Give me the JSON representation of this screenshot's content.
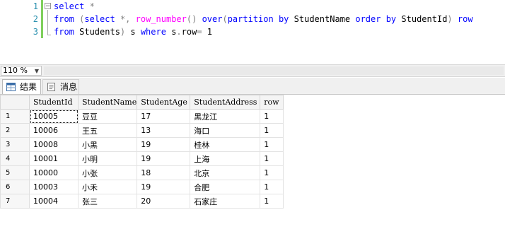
{
  "editor": {
    "line_numbers": [
      "1",
      "2",
      "3"
    ],
    "fold_symbol": "−",
    "lines": [
      [
        {
          "t": "select ",
          "c": "kw"
        },
        {
          "t": "*",
          "c": "gr"
        }
      ],
      [
        {
          "t": "from ",
          "c": "kw"
        },
        {
          "t": "(",
          "c": "gr"
        },
        {
          "t": "select ",
          "c": "kw"
        },
        {
          "t": "*",
          "c": "gr"
        },
        {
          "t": ", ",
          "c": "gr"
        },
        {
          "t": "row_number",
          "c": "fn"
        },
        {
          "t": "() ",
          "c": "gr"
        },
        {
          "t": "over",
          "c": "kw"
        },
        {
          "t": "(",
          "c": "gr"
        },
        {
          "t": "partition ",
          "c": "kw"
        },
        {
          "t": "by ",
          "c": "kw"
        },
        {
          "t": "StudentName ",
          "c": ""
        },
        {
          "t": "order ",
          "c": "kw"
        },
        {
          "t": "by ",
          "c": "kw"
        },
        {
          "t": "StudentId",
          "c": ""
        },
        {
          "t": ") ",
          "c": "gr"
        },
        {
          "t": "row",
          "c": "kw"
        }
      ],
      [
        {
          "t": "from ",
          "c": "kw"
        },
        {
          "t": "Students",
          "c": ""
        },
        {
          "t": ") ",
          "c": "gr"
        },
        {
          "t": "s ",
          "c": ""
        },
        {
          "t": "where ",
          "c": "kw"
        },
        {
          "t": "s",
          "c": ""
        },
        {
          "t": ".",
          "c": "gr"
        },
        {
          "t": "row",
          "c": ""
        },
        {
          "t": "= ",
          "c": "gr"
        },
        {
          "t": "1",
          "c": ""
        }
      ]
    ]
  },
  "zoom": {
    "value": "110 %"
  },
  "tabs": {
    "results_label": "结果",
    "messages_label": "消息"
  },
  "grid": {
    "columns": [
      "StudentId",
      "StudentName",
      "StudentAge",
      "StudentAddress",
      "row"
    ],
    "rows": [
      {
        "n": "1",
        "cells": [
          "10005",
          "豆豆",
          "17",
          "黑龙江",
          "1"
        ]
      },
      {
        "n": "2",
        "cells": [
          "10006",
          "王五",
          "13",
          "海口",
          "1"
        ]
      },
      {
        "n": "3",
        "cells": [
          "10008",
          "小黑",
          "19",
          "桂林",
          "1"
        ]
      },
      {
        "n": "4",
        "cells": [
          "10001",
          "小明",
          "19",
          "上海",
          "1"
        ]
      },
      {
        "n": "5",
        "cells": [
          "10000",
          "小张",
          "18",
          "北京",
          "1"
        ]
      },
      {
        "n": "6",
        "cells": [
          "10003",
          "小禾",
          "19",
          "合肥",
          "1"
        ]
      },
      {
        "n": "7",
        "cells": [
          "10004",
          "张三",
          "20",
          "石家庄",
          "1"
        ]
      }
    ]
  },
  "colors": {
    "line_number": "#2b91af",
    "keyword": "#0000ff",
    "function": "#ff00ff",
    "operator": "#808080",
    "change_bar": "#7fcf5c"
  }
}
